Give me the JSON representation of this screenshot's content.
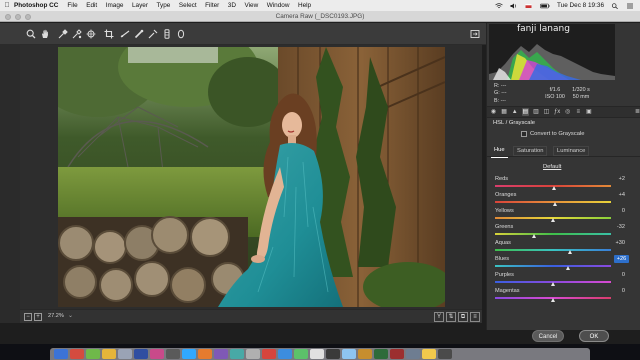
{
  "menubar": {
    "apple_icon": "apple-icon",
    "app_name": "Photoshop CC",
    "items": [
      "File",
      "Edit",
      "Image",
      "Layer",
      "Type",
      "Select",
      "Filter",
      "3D",
      "View",
      "Window",
      "Help"
    ],
    "datetime": "Tue Dec 8  19:36"
  },
  "window": {
    "title": "Camera Raw (_DSC0193.JPG)"
  },
  "toolbar": {
    "tools": [
      "zoom-tool",
      "hand-tool",
      "white-balance-tool",
      "color-sampler-tool",
      "targeted-adjustment-tool",
      "crop-tool",
      "straighten-tool",
      "spot-removal-tool",
      "red-eye-tool",
      "adjustment-brush",
      "graduated-filter",
      "radial-filter"
    ]
  },
  "histogram": {
    "watermark": "fanji lanang"
  },
  "exif": {
    "r_label": "R:",
    "r_value": "---",
    "g_label": "G:",
    "g_value": "---",
    "b_label": "B:",
    "b_value": "---",
    "aperture": "f/1.6",
    "shutter": "1/320 s",
    "iso": "ISO 100",
    "focal": "50 mm"
  },
  "panel": {
    "section_title": "HSL / Grayscale",
    "convert_label": "Convert to Grayscale",
    "convert_checked": false,
    "subtabs": [
      "Hue",
      "Saturation",
      "Luminance"
    ],
    "active_subtab": "Hue",
    "default_link": "Default"
  },
  "sliders": [
    {
      "label": "Reds",
      "value": "+2",
      "num": 2
    },
    {
      "label": "Oranges",
      "value": "+4",
      "num": 4
    },
    {
      "label": "Yellows",
      "value": "0",
      "num": 0
    },
    {
      "label": "Greens",
      "value": "-32",
      "num": -32
    },
    {
      "label": "Aquas",
      "value": "+30",
      "num": 30
    },
    {
      "label": "Blues",
      "value": "+26",
      "num": 26,
      "selected": true
    },
    {
      "label": "Purples",
      "value": "0",
      "num": 0
    },
    {
      "label": "Magentas",
      "value": "0",
      "num": 0
    }
  ],
  "zoom": {
    "value": "27.2%"
  },
  "footer": {
    "cancel_label": "Cancel",
    "ok_label": "OK"
  },
  "colors": {
    "toolbar_bg": "#3b3b3b",
    "panel_bg": "#353535",
    "selection_blue": "#2d6fcb"
  }
}
